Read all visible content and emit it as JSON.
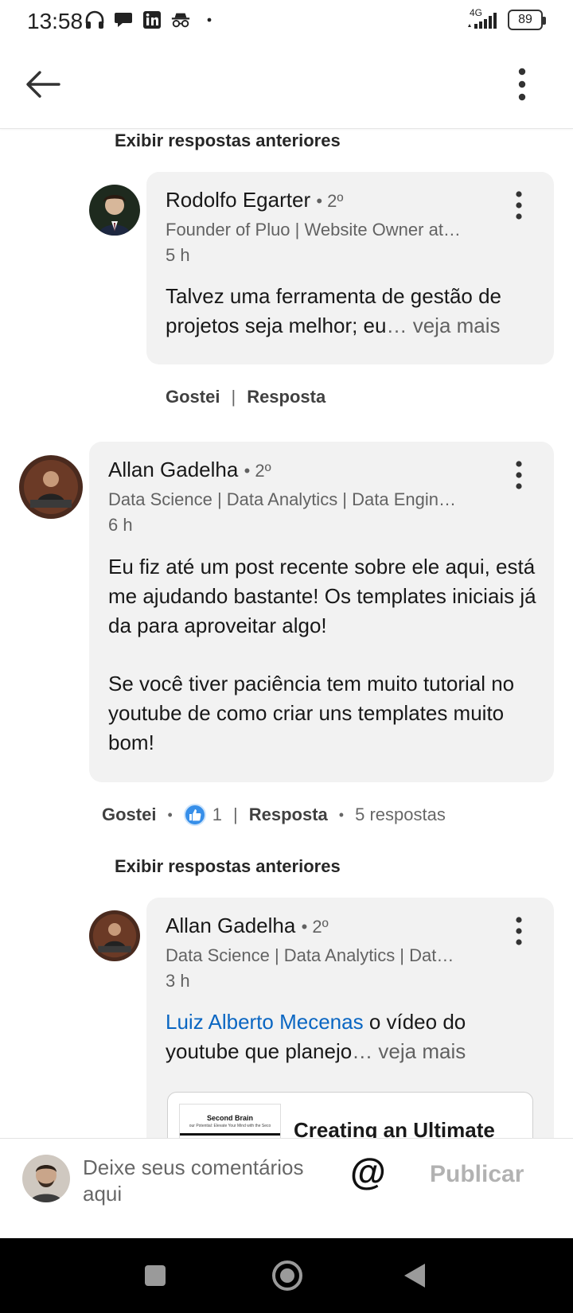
{
  "status_bar": {
    "time": "13:58",
    "network": "4G",
    "battery": "89"
  },
  "header": {},
  "thread": {
    "show_previous_top": "Exibir respostas anteriores",
    "show_previous_mid": "Exibir respostas anteriores",
    "comments": [
      {
        "name": "Rodolfo Egarter",
        "degree": "• 2º",
        "headline": "Founder of Pluo | Website Owner at…",
        "time": "5 h",
        "text": "Talvez uma ferramenta de gestão de projetos seja melhor; eu",
        "ellipsis": "… veja mais",
        "like_label": "Gostei",
        "separator": "|",
        "reply_label": "Resposta"
      },
      {
        "name": "Allan Gadelha",
        "degree": "• 2º",
        "headline": "Data Science | Data Analytics | Data Engin…",
        "time": "6 h",
        "text_p1": "Eu fiz até um post recente sobre ele aqui, está me ajudando bastante! Os templates iniciais já da para aproveitar algo!",
        "text_p2": "Se você tiver paciência tem muito tutorial no youtube de como criar uns templates muito bom!",
        "like_label": "Gostei",
        "dot": "•",
        "reaction_count": "1",
        "separator": "|",
        "reply_label": "Resposta",
        "replies_count": "5 respostas"
      },
      {
        "name": "Allan Gadelha",
        "degree": "• 2º",
        "headline": "Data Science | Data Analytics | Dat…",
        "time": "3 h",
        "mention": "Luiz Alberto Mecenas",
        "text": " o vídeo do youtube que planejo",
        "ellipsis": "… veja mais",
        "link_card": {
          "thumb_title": "Second Brain",
          "thumb_subtitle": "our Potential: Elevate Your Mind with the Seco",
          "title": "Creating an Ultimate"
        }
      }
    ]
  },
  "composer": {
    "placeholder": "Deixe seus comentários aqui",
    "at_symbol": "@",
    "publish_label": "Publicar"
  },
  "colors": {
    "link": "#0a66c2",
    "reaction_like": "#378fe9",
    "bubble": "#f2f2f2"
  }
}
